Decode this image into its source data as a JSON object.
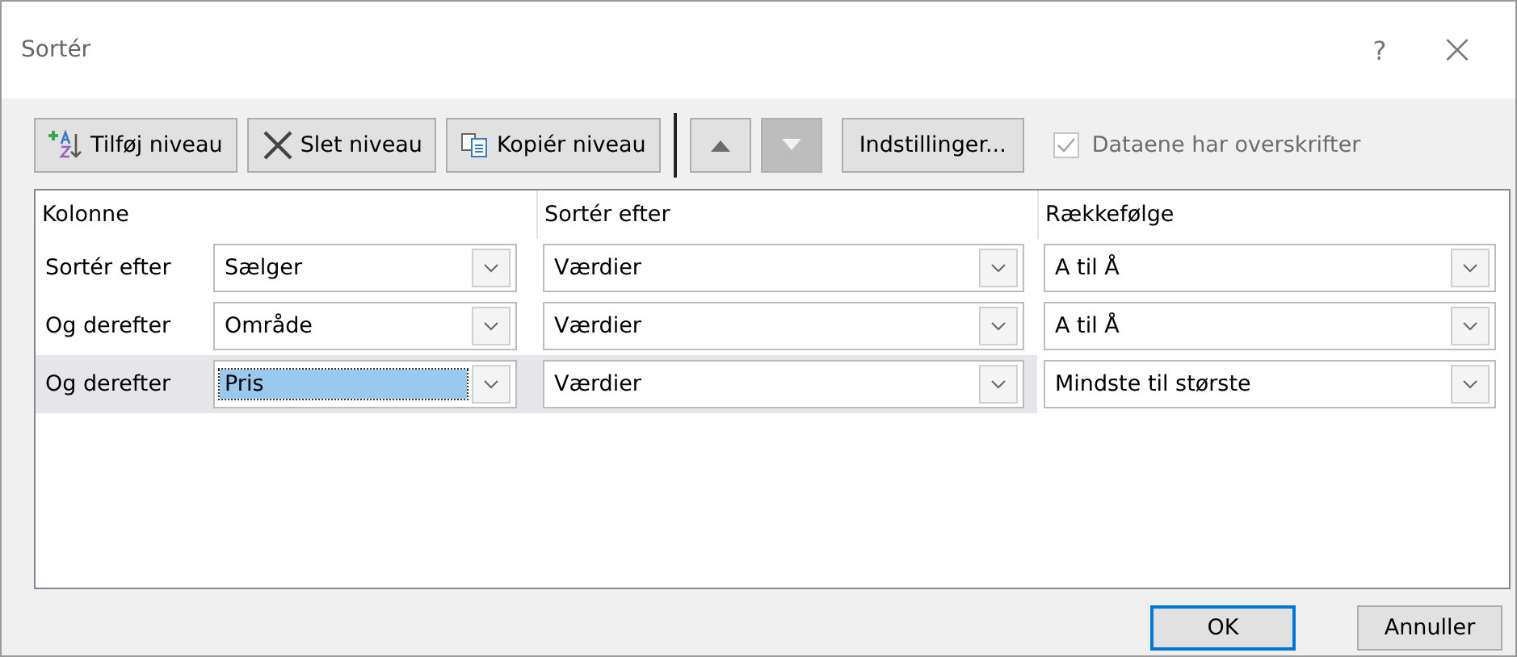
{
  "window": {
    "title": "Sortér",
    "help": "?",
    "close": "×"
  },
  "toolbar": {
    "buttons": [
      {
        "kind": "add",
        "label": "Tilføj niveau",
        "disabled": false
      },
      {
        "kind": "delete",
        "label": "Slet niveau",
        "disabled": false
      },
      {
        "kind": "copy",
        "label": "Kopiér niveau",
        "disabled": false
      },
      {
        "kind": "up",
        "disabled": false
      },
      {
        "kind": "down",
        "disabled": true
      },
      {
        "kind": "text",
        "label": "Indstillinger...",
        "disabled": false
      }
    ],
    "header_checkbox": {
      "label": "Dataene har overskrifter",
      "checked": true,
      "disabled": true
    }
  },
  "table": {
    "columns": [
      "Kolonne",
      "Sortér efter",
      "Rækkefølge"
    ],
    "rows": [
      {
        "label": "Sortér efter",
        "column": "Sælger",
        "sort_on": "Værdier",
        "order": "A til Å",
        "selected": false
      },
      {
        "label": "Og derefter",
        "column": "Område",
        "sort_on": "Værdier",
        "order": "A til Å",
        "selected": false
      },
      {
        "label": "Og derefter",
        "column": "Pris",
        "sort_on": "Værdier",
        "order": "Mindste til største",
        "selected": true
      }
    ]
  },
  "buttons": [
    {
      "label": "OK",
      "default": true
    },
    {
      "label": "Annuller",
      "default": false
    }
  ]
}
